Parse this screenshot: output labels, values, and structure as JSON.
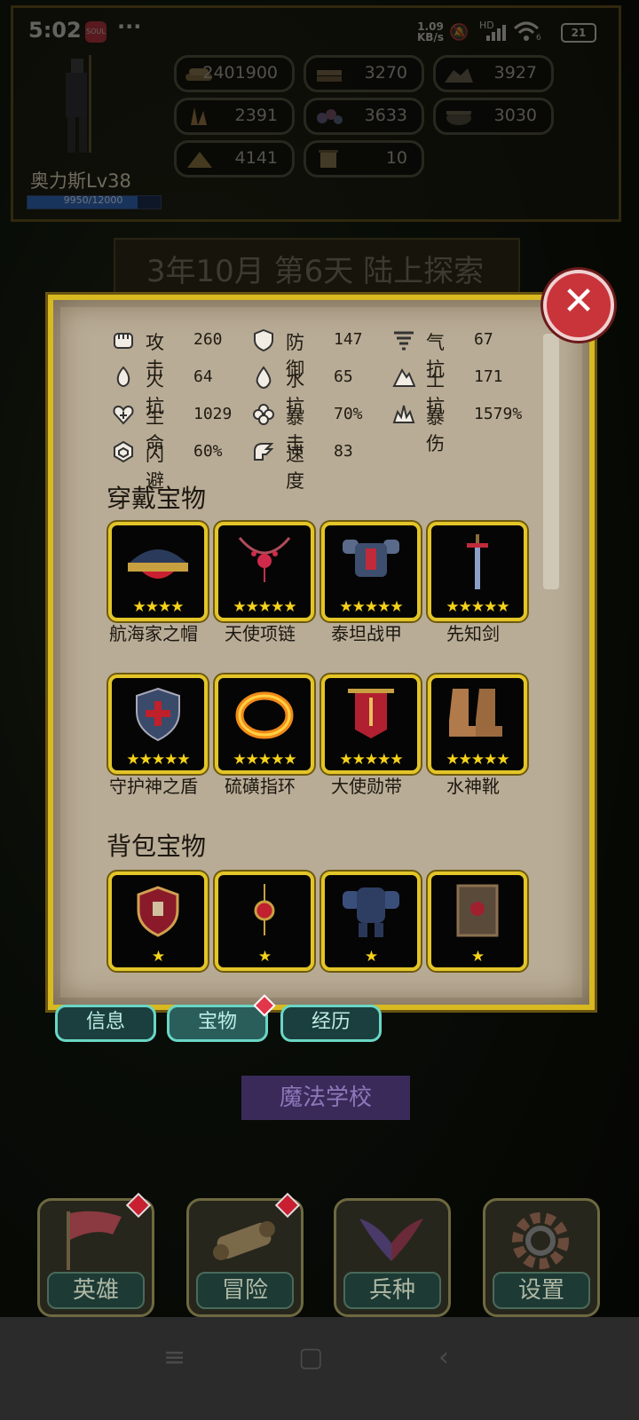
{
  "status_bar": {
    "time": "5:02",
    "app_badge": "SOUL",
    "more": "···",
    "net_speed_value": "1.09",
    "net_speed_unit": "KB/s",
    "signal_label": "HD",
    "wifi_sub": "6",
    "battery": "21"
  },
  "hero": {
    "name": "奥力斯Lv38",
    "xp_text": "9950/12000",
    "xp_fraction": 0.829
  },
  "resources": [
    {
      "icon": "wood-pile-icon",
      "value": "2401900"
    },
    {
      "icon": "lumber-icon",
      "value": "3270"
    },
    {
      "icon": "ore-icon",
      "value": "3927"
    },
    {
      "icon": "crystal-icon",
      "value": "2391"
    },
    {
      "icon": "gems-icon",
      "value": "3633"
    },
    {
      "icon": "cauldron-icon",
      "value": "3030"
    },
    {
      "icon": "sulfur-icon",
      "value": "4141"
    },
    {
      "icon": "scroll-icon",
      "value": "10"
    }
  ],
  "date_banner": "3年10月 第6天 陆上探索",
  "close_label": "✕",
  "stats": [
    {
      "icon": "fist-icon",
      "label": "攻击",
      "value": "260"
    },
    {
      "icon": "shield-icon",
      "label": "防御",
      "value": "147"
    },
    {
      "icon": "tornado-icon",
      "label": "气抗",
      "value": "67"
    },
    {
      "icon": "fire-icon",
      "label": "火抗",
      "value": "64"
    },
    {
      "icon": "water-drop-icon",
      "label": "水抗",
      "value": "65"
    },
    {
      "icon": "mountain-icon",
      "label": "土抗",
      "value": "171"
    },
    {
      "icon": "heart-plus-icon",
      "label": "生命",
      "value": "1029"
    },
    {
      "icon": "clover-icon",
      "label": "暴击",
      "value": "70%"
    },
    {
      "icon": "burst-icon",
      "label": "暴伤",
      "value": "1579%"
    },
    {
      "icon": "dodge-icon",
      "label": "闪避",
      "value": "60%"
    },
    {
      "icon": "boot-wing-icon",
      "label": "速度",
      "value": "83"
    }
  ],
  "sections": {
    "worn": "穿戴宝物",
    "bag": "背包宝物"
  },
  "worn_items": [
    {
      "name": "航海家之帽",
      "stars": "★★★★",
      "icon": "hat-icon"
    },
    {
      "name": "天使项链",
      "stars": "★★★★★",
      "icon": "necklace-icon"
    },
    {
      "name": "泰坦战甲",
      "stars": "★★★★★",
      "icon": "armor-icon"
    },
    {
      "name": "先知剑",
      "stars": "★★★★★",
      "icon": "sword-icon"
    },
    {
      "name": "守护神之盾",
      "stars": "★★★★★",
      "icon": "shield-item-icon"
    },
    {
      "name": "硫磺指环",
      "stars": "★★★★★",
      "icon": "ring-icon"
    },
    {
      "name": "大使勋带",
      "stars": "★★★★★",
      "icon": "banner-sash-icon"
    },
    {
      "name": "水神靴",
      "stars": "★★★★★",
      "icon": "boots-icon"
    }
  ],
  "bag_items": [
    {
      "stars": "★",
      "icon": "crest-shield-icon"
    },
    {
      "stars": "★",
      "icon": "pendant-icon"
    },
    {
      "stars": "★",
      "icon": "golem-armor-icon"
    },
    {
      "stars": "★",
      "icon": "tome-icon"
    }
  ],
  "tabs": [
    {
      "label": "信息",
      "active": false
    },
    {
      "label": "宝物",
      "active": true
    },
    {
      "label": "经历",
      "active": false
    }
  ],
  "location_label": "魔法学校",
  "bottom_nav": [
    {
      "label": "英雄",
      "icon": "flag-icon",
      "badge": true
    },
    {
      "label": "冒险",
      "icon": "map-scroll-icon",
      "badge": true
    },
    {
      "label": "兵种",
      "icon": "wings-icon",
      "badge": false
    },
    {
      "label": "设置",
      "icon": "gear-icon",
      "badge": false
    }
  ],
  "system_nav": {
    "menu": "≡",
    "home": "▢",
    "back": "‹"
  },
  "colors": {
    "frame_gold": "#d8b920",
    "parchment": "#b9ac96",
    "close_red": "#c8343a",
    "tab_teal": "#6ad6c6",
    "star_gold": "#f5d21a"
  }
}
